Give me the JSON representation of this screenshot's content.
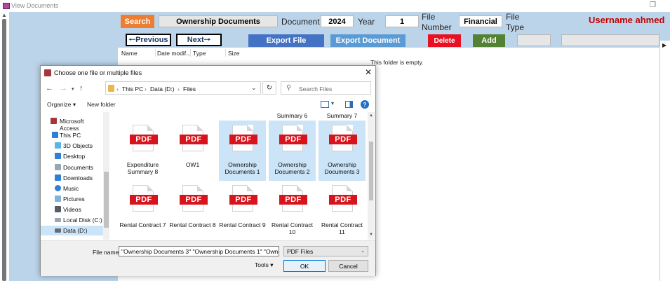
{
  "window": {
    "title": "View Documents",
    "restore_glyph": "❐"
  },
  "form": {
    "search_label": "Search",
    "document_value": "Ownership Documents",
    "document_label": "Document",
    "year_value": "2024",
    "year_label": "Year",
    "file_number_value": "1",
    "file_number_label_1": "File",
    "file_number_label_2": "Number",
    "file_type_value": "Financial",
    "file_type_label_1": "File",
    "file_type_label_2": "Type",
    "username_label": "Username ahmed",
    "previous_label": "🠐Previous",
    "next_label": "Next🠒",
    "export_file_label": "Export File",
    "export_document_label": "Export Document",
    "delete_label": "Delete",
    "add_label": "Add",
    "colors": {
      "search_bg": "#ed7d31",
      "export_file_bg": "#4472c4",
      "export_document_bg": "#5b9bd5",
      "delete_bg": "#e81123",
      "add_bg": "#548235",
      "username_color": "#c00000"
    }
  },
  "list": {
    "columns": [
      "Name",
      "Date modif...",
      "Type",
      "Size"
    ],
    "empty_message": "This folder is empty."
  },
  "dialog": {
    "title": "Choose one file or multiple files",
    "close_glyph": "✕",
    "breadcrumbs": [
      "This PC",
      "Data (D:)",
      "Files"
    ],
    "search_placeholder": "Search Files",
    "organize_label": "Organize ▾",
    "new_folder_label": "New folder",
    "help_glyph": "?",
    "nav_items": [
      {
        "label": "Microsoft Access",
        "icon": "access-icon"
      },
      {
        "label": "This PC",
        "icon": "computer-icon"
      },
      {
        "label": "3D Objects",
        "icon": "cube-icon"
      },
      {
        "label": "Desktop",
        "icon": "desktop-icon"
      },
      {
        "label": "Documents",
        "icon": "documents-icon"
      },
      {
        "label": "Downloads",
        "icon": "download-icon"
      },
      {
        "label": "Music",
        "icon": "music-icon"
      },
      {
        "label": "Pictures",
        "icon": "pictures-icon"
      },
      {
        "label": "Videos",
        "icon": "videos-icon"
      },
      {
        "label": "Local Disk (C:)",
        "icon": "drive-icon"
      },
      {
        "label": "Data (D:)",
        "icon": "drive-icon"
      }
    ],
    "partial_row_labels": [
      "Summary 6",
      "Summary 7"
    ],
    "files_row1": [
      {
        "name": "Expenditure Summary 8",
        "selected": false
      },
      {
        "name": "OW1",
        "selected": false
      },
      {
        "name": "Ownership Documents 1",
        "selected": true
      },
      {
        "name": "Ownership Documents 2",
        "selected": true
      },
      {
        "name": "Ownership Documents 3",
        "selected": true
      }
    ],
    "files_row2": [
      {
        "name": "Rental Contract 7",
        "selected": false
      },
      {
        "name": "Rental Contract 8",
        "selected": false
      },
      {
        "name": "Rental Contract 9",
        "selected": false
      },
      {
        "name": "Rental Contract 10",
        "selected": false
      },
      {
        "name": "Rental Contract 11",
        "selected": false
      }
    ],
    "pdf_badge": "PDF",
    "file_name_label": "File name:",
    "file_name_value": "\"Ownership Documents 3\" \"Ownership Documents 1\" \"Ownership Documents 2\"",
    "file_type_value": "PDF Files",
    "tools_label": "Tools  ▾",
    "ok_label": "OK",
    "cancel_label": "Cancel"
  }
}
